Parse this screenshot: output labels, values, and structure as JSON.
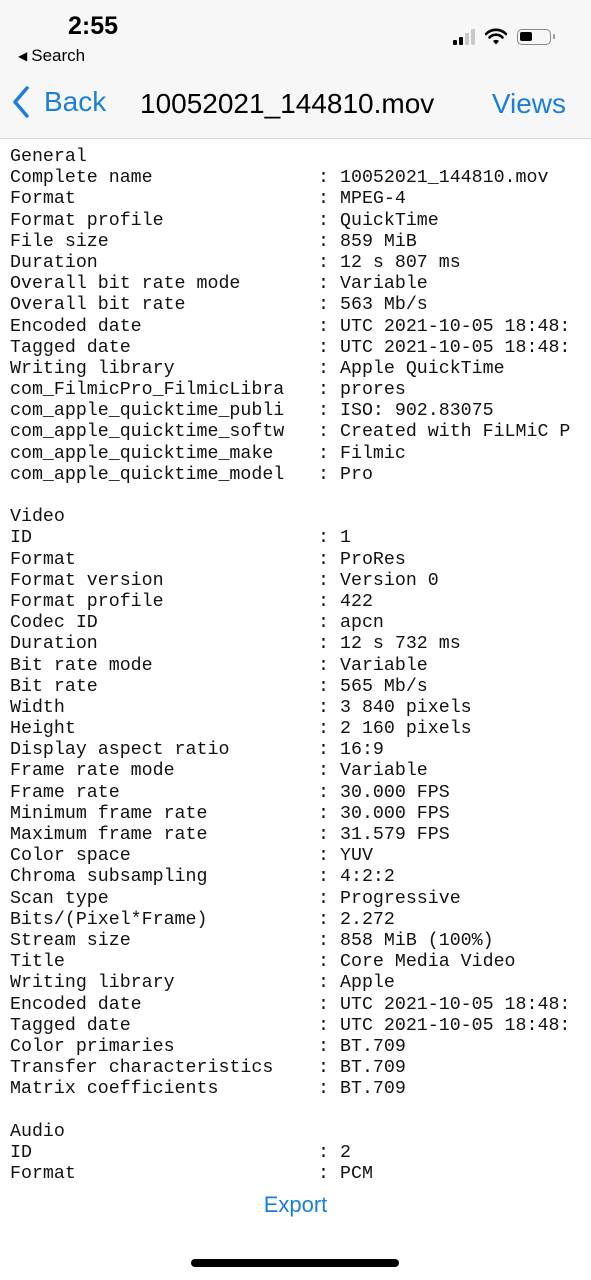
{
  "status_bar": {
    "time": "2:55",
    "back_app_label": "Search"
  },
  "nav": {
    "back_label": "Back",
    "title": "10052021_144810.mov",
    "views_label": "Views"
  },
  "sections": [
    {
      "title": "General",
      "rows": [
        {
          "label": "Complete name",
          "value": "10052021_144810.mov"
        },
        {
          "label": "Format",
          "value": "MPEG-4"
        },
        {
          "label": "Format profile",
          "value": "QuickTime"
        },
        {
          "label": "File size",
          "value": "859 MiB"
        },
        {
          "label": "Duration",
          "value": "12 s 807 ms"
        },
        {
          "label": "Overall bit rate mode",
          "value": "Variable"
        },
        {
          "label": "Overall bit rate",
          "value": "563 Mb/s"
        },
        {
          "label": "Encoded date",
          "value": "UTC 2021-10-05 18:48:"
        },
        {
          "label": "Tagged date",
          "value": "UTC 2021-10-05 18:48:"
        },
        {
          "label": "Writing library",
          "value": "Apple QuickTime"
        },
        {
          "label": "com_FilmicPro_FilmicLibra",
          "value": "prores"
        },
        {
          "label": "com_apple_quicktime_publi",
          "value": "ISO: 902.83075"
        },
        {
          "label": "com_apple_quicktime_softw",
          "value": "Created with FiLMiC P"
        },
        {
          "label": "com_apple_quicktime_make",
          "value": "Filmic"
        },
        {
          "label": "com_apple_quicktime_model",
          "value": "Pro"
        }
      ]
    },
    {
      "title": "Video",
      "rows": [
        {
          "label": "ID",
          "value": "1"
        },
        {
          "label": "Format",
          "value": "ProRes"
        },
        {
          "label": "Format version",
          "value": "Version 0"
        },
        {
          "label": "Format profile",
          "value": "422"
        },
        {
          "label": "Codec ID",
          "value": "apcn"
        },
        {
          "label": "Duration",
          "value": "12 s 732 ms"
        },
        {
          "label": "Bit rate mode",
          "value": "Variable"
        },
        {
          "label": "Bit rate",
          "value": "565 Mb/s"
        },
        {
          "label": "Width",
          "value": "3 840 pixels"
        },
        {
          "label": "Height",
          "value": "2 160 pixels"
        },
        {
          "label": "Display aspect ratio",
          "value": "16:9"
        },
        {
          "label": "Frame rate mode",
          "value": "Variable"
        },
        {
          "label": "Frame rate",
          "value": "30.000 FPS"
        },
        {
          "label": "Minimum frame rate",
          "value": "30.000 FPS"
        },
        {
          "label": "Maximum frame rate",
          "value": "31.579 FPS"
        },
        {
          "label": "Color space",
          "value": "YUV"
        },
        {
          "label": "Chroma subsampling",
          "value": "4:2:2"
        },
        {
          "label": "Scan type",
          "value": "Progressive"
        },
        {
          "label": "Bits/(Pixel*Frame)",
          "value": "2.272"
        },
        {
          "label": "Stream size",
          "value": "858 MiB (100%)"
        },
        {
          "label": "Title",
          "value": "Core Media Video"
        },
        {
          "label": "Writing library",
          "value": "Apple"
        },
        {
          "label": "Encoded date",
          "value": "UTC 2021-10-05 18:48:"
        },
        {
          "label": "Tagged date",
          "value": "UTC 2021-10-05 18:48:"
        },
        {
          "label": "Color primaries",
          "value": "BT.709"
        },
        {
          "label": "Transfer characteristics",
          "value": "BT.709"
        },
        {
          "label": "Matrix coefficients",
          "value": "BT.709"
        }
      ]
    },
    {
      "title": "Audio",
      "rows": [
        {
          "label": "ID",
          "value": "2"
        },
        {
          "label": "Format",
          "value": "PCM"
        }
      ]
    }
  ],
  "separator": ":",
  "export_label": "Export",
  "colors": {
    "accent": "#1a7fd6",
    "header_bg": "#f7f7f7"
  }
}
